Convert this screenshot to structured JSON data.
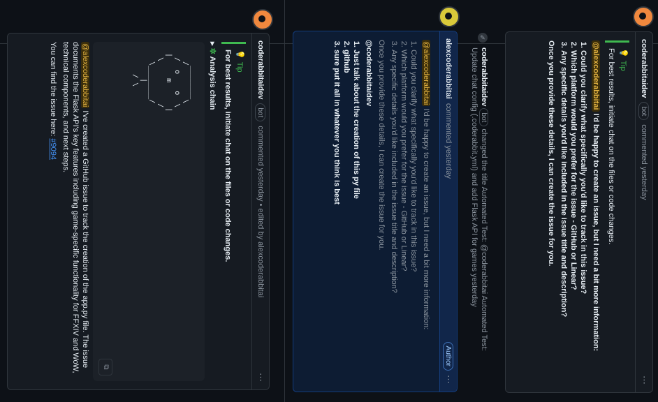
{
  "comment1": {
    "author": "coderabbitaidev",
    "bot_badge": "bot",
    "meta": "commented yesterday",
    "tip_title": "Tip",
    "tip_text": "For best results, initiate chat on the files or code changes.",
    "mention": "@alexcoderabbitai",
    "intro": " I'd be happy to create an issue, but I need a bit more information:",
    "items": [
      "Could you clarify what specifically you'd like to track in this issue?",
      "Which platform would you prefer for the issue - GitHub or Linear?",
      "Any specific details you'd like included in the issue title and description?"
    ],
    "outro": "Once you provide these details, I can create the issue for you."
  },
  "event": {
    "actor": "coderabbitaidev",
    "bot_badge": "bot",
    "text": " changed the title Automated Test: @coderabbitai Automated Test: Update chat config (.coderabbit.yml) and add Flask API for games yesterday"
  },
  "comment2": {
    "author": "alexcoderabbitai",
    "meta": "commented yesterday",
    "author_badge": "Author",
    "mention": "@alexcoderabbitai",
    "intro": " I'd be happy to create an issue, but I need a bit more information:",
    "items": [
      "Could you clarify what specifically you'd like to track in this issue?",
      "Which platform would you prefer for the issue - GitHub or Linear?",
      "Any specific details you'd like included in the issue title and description?"
    ],
    "outro": "Once you provide these details, I can create the issue for you.",
    "reply_mention": "@coderabbitaidev",
    "reply_items": [
      "Just talk about the creation of this py file",
      "github",
      "sure put it all in whatever you think is best"
    ]
  },
  "comment3": {
    "author": "coderabbitaidev",
    "bot_badge": "bot",
    "meta": "commented yesterday • edited by alexcoderabbitai",
    "tip_title": "Tip",
    "tip_text": "For best results, initiate chat on the files or code changes.",
    "analysis_label": "Analysis chain",
    "ascii_art": "    ________\n   /        \\\n  /  o    o  \\\n |     m      |\n  \\          /\n   \\________/\n       |\n      / \\",
    "mention": "@alexcoderabbitai",
    "body": " I've created a GitHub issue to track the creation of the app.py file. The issue documents the Flask API's key features including game-specific functionality for FFXIV and WoW, technical components, and next steps.",
    "issue_prefix": "You can find the issue here: ",
    "issue_link": "#9094"
  },
  "colors": {
    "accent": "#4493f8",
    "tip": "#3fb950",
    "mention": "#e3b341",
    "bot_avatar": "#f0883e"
  },
  "icons": [
    "kebab-icon",
    "lightbulb-icon",
    "copy-icon",
    "pencil-icon",
    "smiley-icon"
  ]
}
